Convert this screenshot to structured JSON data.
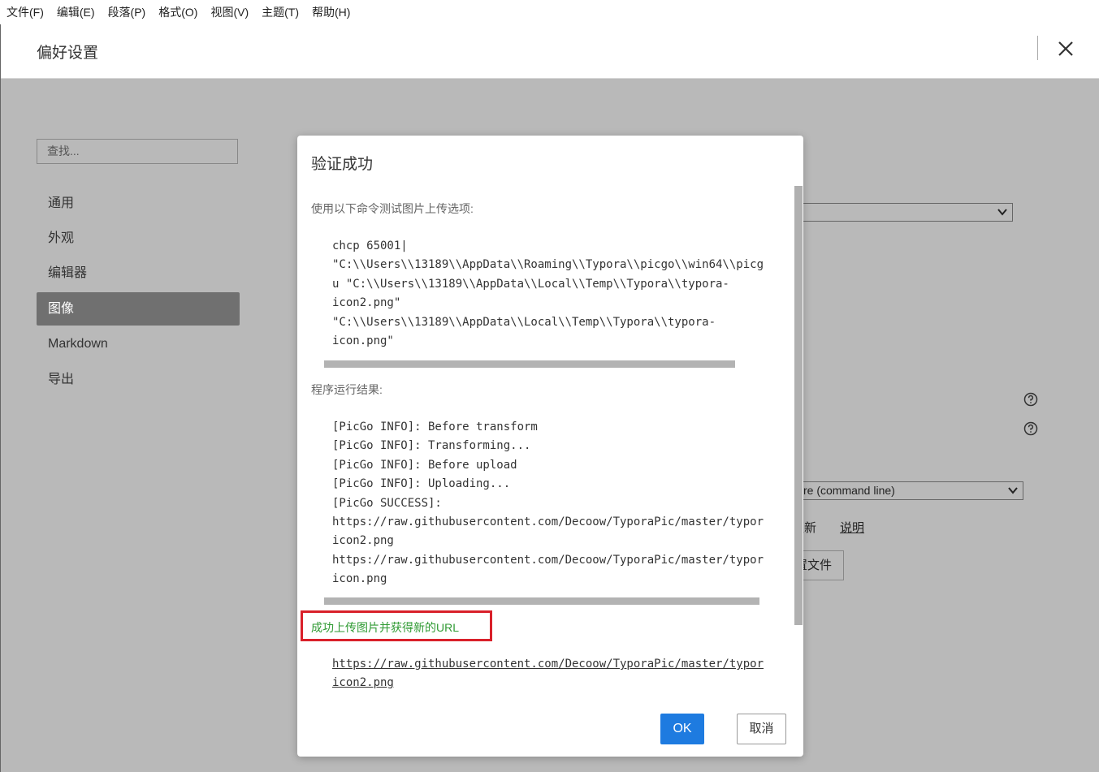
{
  "menu": [
    "文件(F)",
    "编辑(E)",
    "段落(P)",
    "格式(O)",
    "视图(V)",
    "主题(T)",
    "帮助(H)"
  ],
  "prefs": {
    "title": "偏好设置"
  },
  "sidebar": {
    "search_placeholder": "查找...",
    "items": [
      {
        "label": "通用"
      },
      {
        "label": "外观"
      },
      {
        "label": "编辑器"
      },
      {
        "label": "图像",
        "active": true
      },
      {
        "label": "Markdown"
      },
      {
        "label": "导出"
      }
    ]
  },
  "background_fragments": {
    "uploader_select": "re (command line)",
    "update_fragment": "更新",
    "explain_link": "说明",
    "config_fragment": "置文件"
  },
  "dialog": {
    "title": "验证成功",
    "test_label": "使用以下命令测试图片上传选项:",
    "command_lines": [
      "chcp 65001|",
      "\"C:\\\\Users\\\\13189\\\\AppData\\\\Roaming\\\\Typora\\\\picgo\\\\win64\\\\picg",
      "u \"C:\\\\Users\\\\13189\\\\AppData\\\\Local\\\\Temp\\\\Typora\\\\typora-",
      "icon2.png\"",
      "\"C:\\\\Users\\\\13189\\\\AppData\\\\Local\\\\Temp\\\\Typora\\\\typora-",
      "icon.png\""
    ],
    "result_label": "程序运行结果:",
    "output_lines": [
      "[PicGo INFO]: Before transform",
      "[PicGo INFO]: Transforming...",
      "[PicGo INFO]: Before upload",
      "[PicGo INFO]: Uploading...",
      "[PicGo SUCCESS]:",
      "https://raw.githubusercontent.com/Decoow/TyporaPic/master/typor",
      "icon2.png",
      "https://raw.githubusercontent.com/Decoow/TyporaPic/master/typor",
      "icon.png"
    ],
    "success_text": "成功上传图片并获得新的URL",
    "url_lines": [
      "https://raw.githubusercontent.com/Decoow/TyporaPic/master/typor",
      "icon2.png"
    ],
    "ok_label": "OK",
    "cancel_label": "取消"
  }
}
